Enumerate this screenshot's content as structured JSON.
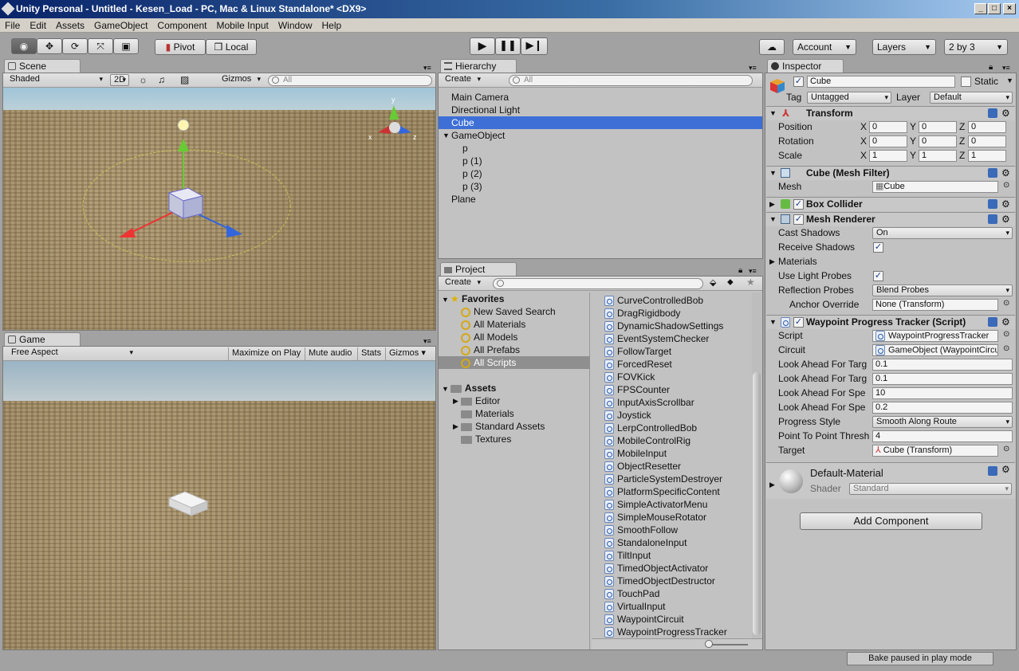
{
  "window": {
    "title": "Unity Personal - Untitled - Kesen_Load - PC, Mac & Linux Standalone* <DX9>"
  },
  "menu": [
    "File",
    "Edit",
    "Assets",
    "GameObject",
    "Component",
    "Mobile Input",
    "Window",
    "Help"
  ],
  "toolbar": {
    "pivot": "Pivot",
    "local": "Local",
    "account": "Account",
    "layers": "Layers",
    "layout": "2 by 3"
  },
  "scene": {
    "tab": "Scene",
    "shading": "Shaded",
    "mode2d": "2D",
    "gizmos": "Gizmos",
    "search_placeholder": "All"
  },
  "game": {
    "tab": "Game",
    "aspect": "Free Aspect",
    "maximize": "Maximize on Play",
    "mute": "Mute audio",
    "stats": "Stats",
    "gizmos": "Gizmos"
  },
  "hierarchy": {
    "tab": "Hierarchy",
    "create": "Create",
    "search_placeholder": "All",
    "items": [
      {
        "label": "Main Camera",
        "indent": 0,
        "selected": false
      },
      {
        "label": "Directional Light",
        "indent": 0,
        "selected": false
      },
      {
        "label": "Cube",
        "indent": 0,
        "selected": true
      },
      {
        "label": "GameObject",
        "indent": 0,
        "selected": false,
        "expanded": true
      },
      {
        "label": "p",
        "indent": 1,
        "selected": false
      },
      {
        "label": "p (1)",
        "indent": 1,
        "selected": false
      },
      {
        "label": "p (2)",
        "indent": 1,
        "selected": false
      },
      {
        "label": "p (3)",
        "indent": 1,
        "selected": false
      },
      {
        "label": "Plane",
        "indent": 0,
        "selected": false
      }
    ]
  },
  "project": {
    "tab": "Project",
    "create": "Create",
    "favorites_label": "Favorites",
    "favorites": [
      "New Saved Search",
      "All Materials",
      "All Models",
      "All Prefabs",
      "All Scripts"
    ],
    "assets_label": "Assets",
    "assets": [
      "Editor",
      "Materials",
      "Standard Assets",
      "Textures"
    ],
    "scripts": [
      "CurveControlledBob",
      "DragRigidbody",
      "DynamicShadowSettings",
      "EventSystemChecker",
      "FollowTarget",
      "ForcedReset",
      "FOVKick",
      "FPSCounter",
      "InputAxisScrollbar",
      "Joystick",
      "LerpControlledBob",
      "MobileControlRig",
      "MobileInput",
      "ObjectResetter",
      "ParticleSystemDestroyer",
      "PlatformSpecificContent",
      "SimpleActivatorMenu",
      "SimpleMouseRotator",
      "SmoothFollow",
      "StandaloneInput",
      "TiltInput",
      "TimedObjectActivator",
      "TimedObjectDestructor",
      "TouchPad",
      "VirtualInput",
      "WaypointCircuit",
      "WaypointProgressTracker"
    ]
  },
  "inspector": {
    "tab": "Inspector",
    "object_name": "Cube",
    "static_label": "Static",
    "tag_label": "Tag",
    "tag_value": "Untagged",
    "layer_label": "Layer",
    "layer_value": "Default",
    "transform": {
      "title": "Transform",
      "rows": [
        {
          "label": "Position",
          "x": "0",
          "y": "0",
          "z": "0"
        },
        {
          "label": "Rotation",
          "x": "0",
          "y": "0",
          "z": "0"
        },
        {
          "label": "Scale",
          "x": "1",
          "y": "1",
          "z": "1"
        }
      ]
    },
    "axis": {
      "x": "X",
      "y": "Y",
      "z": "Z"
    },
    "mesh_filter": {
      "title": "Cube (Mesh Filter)",
      "mesh_label": "Mesh",
      "mesh_value": "Cube"
    },
    "box_collider": {
      "title": "Box Collider"
    },
    "mesh_renderer": {
      "title": "Mesh Renderer",
      "cast_shadows_label": "Cast Shadows",
      "cast_shadows_value": "On",
      "receive_shadows_label": "Receive Shadows",
      "materials_label": "Materials",
      "light_probes_label": "Use Light Probes",
      "reflection_label": "Reflection Probes",
      "reflection_value": "Blend Probes",
      "anchor_label": "Anchor Override",
      "anchor_value": "None (Transform)"
    },
    "waypoint": {
      "title": "Waypoint Progress Tracker (Script)",
      "script_label": "Script",
      "script_value": "WaypointProgressTracker",
      "circuit_label": "Circuit",
      "circuit_value": "GameObject (WaypointCircuit)",
      "la1_label": "Look Ahead For Targ",
      "la1_value": "0.1",
      "la2_label": "Look Ahead For Targ",
      "la2_value": "0.1",
      "la3_label": "Look Ahead For Spe",
      "la3_value": "10",
      "la4_label": "Look Ahead For Spe",
      "la4_value": "0.2",
      "style_label": "Progress Style",
      "style_value": "Smooth Along Route",
      "ptp_label": "Point To Point Thresh",
      "ptp_value": "4",
      "target_label": "Target",
      "target_value": "Cube (Transform)"
    },
    "material": {
      "name": "Default-Material",
      "shader_label": "Shader",
      "shader_value": "Standard"
    },
    "add_component": "Add Component"
  },
  "status": {
    "bake": "Bake paused in play mode"
  }
}
